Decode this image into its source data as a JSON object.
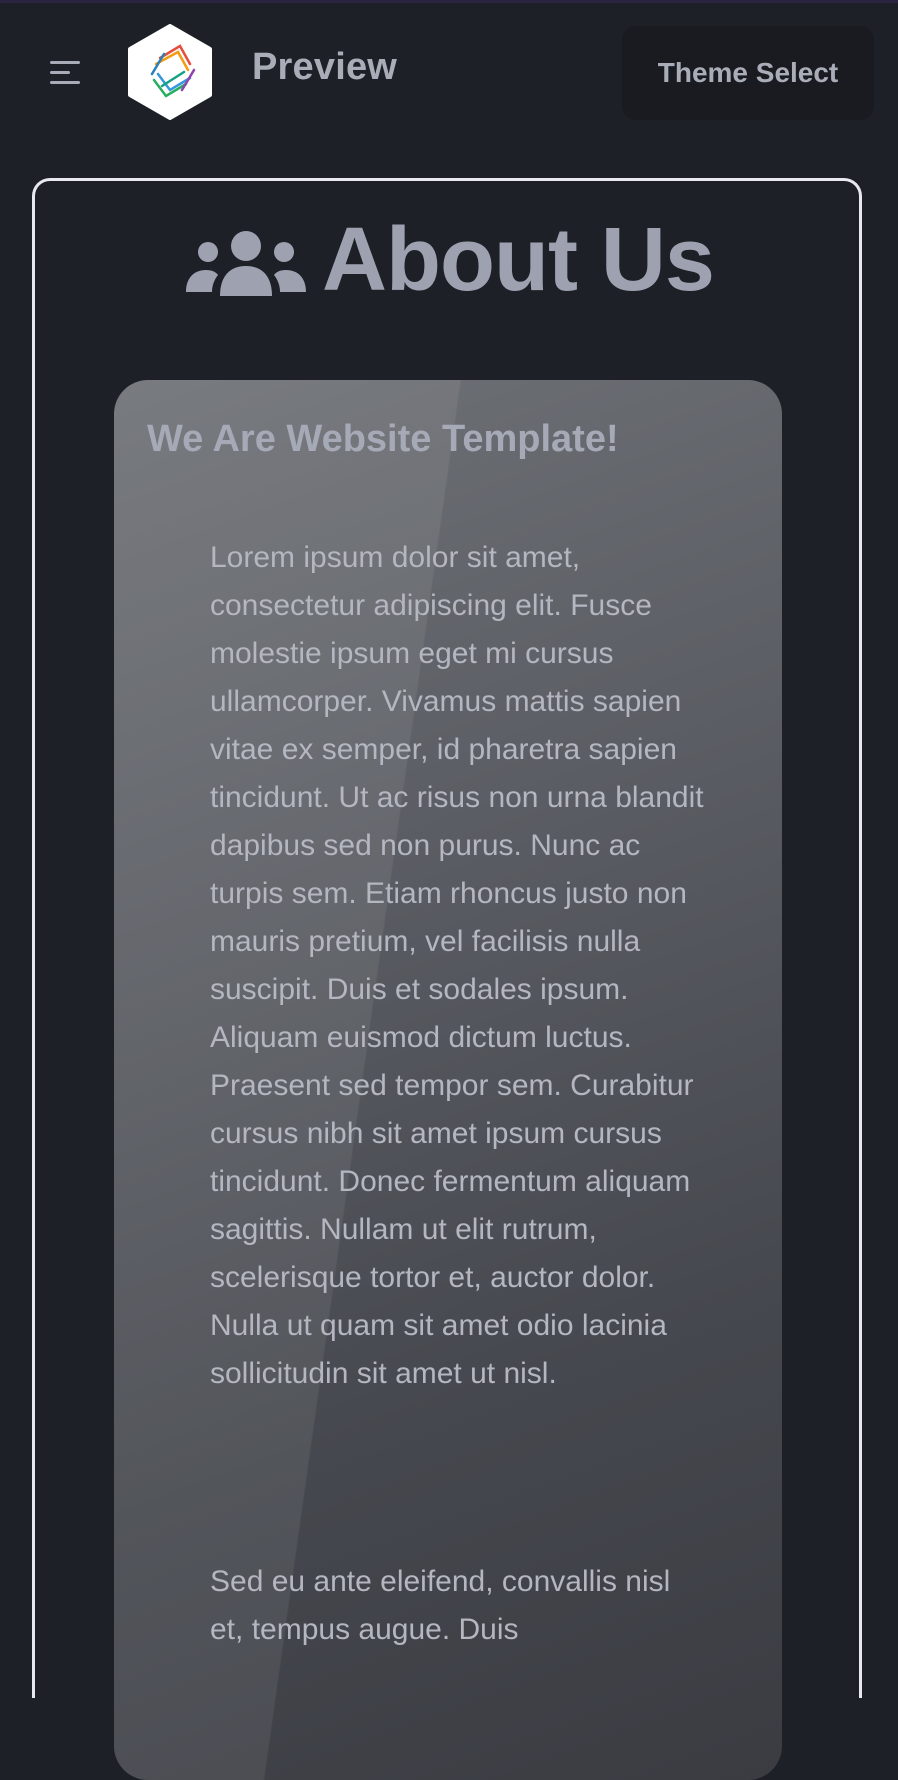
{
  "header": {
    "brand": "Preview",
    "theme_button": "Theme Select"
  },
  "page": {
    "title": "About Us"
  },
  "card": {
    "heading": "We Are Website Template!",
    "paragraph_1": "Lorem ipsum dolor sit amet, consectetur adipiscing elit. Fusce molestie ipsum eget mi cursus ullamcorper. Vivamus mattis sapien vitae ex semper, id pharetra sapien tincidunt. Ut ac risus non urna blandit dapibus sed non purus. Nunc ac turpis sem. Etiam rhoncus justo non mauris pretium, vel facilisis nulla suscipit. Duis et sodales ipsum. Aliquam euismod dictum luctus. Praesent sed tempor sem. Curabitur cursus nibh sit amet ipsum cursus tincidunt. Donec fermentum aliquam sagittis. Nullam ut elit rutrum, scelerisque tortor et, auctor dolor. Nulla ut quam sit amet odio lacinia sollicitudin sit amet ut nisl.",
    "paragraph_2": "Sed eu ante eleifend, convallis nisl et, tempus augue. Duis"
  },
  "icons": {
    "menu": "hamburger-menu-icon",
    "logo": "app-logo",
    "heading": "users-icon"
  },
  "colors": {
    "background": "#1d2027",
    "text_muted": "#a9adb8",
    "button_bg": "#191b20",
    "frame_border": "#e8e9ee"
  }
}
